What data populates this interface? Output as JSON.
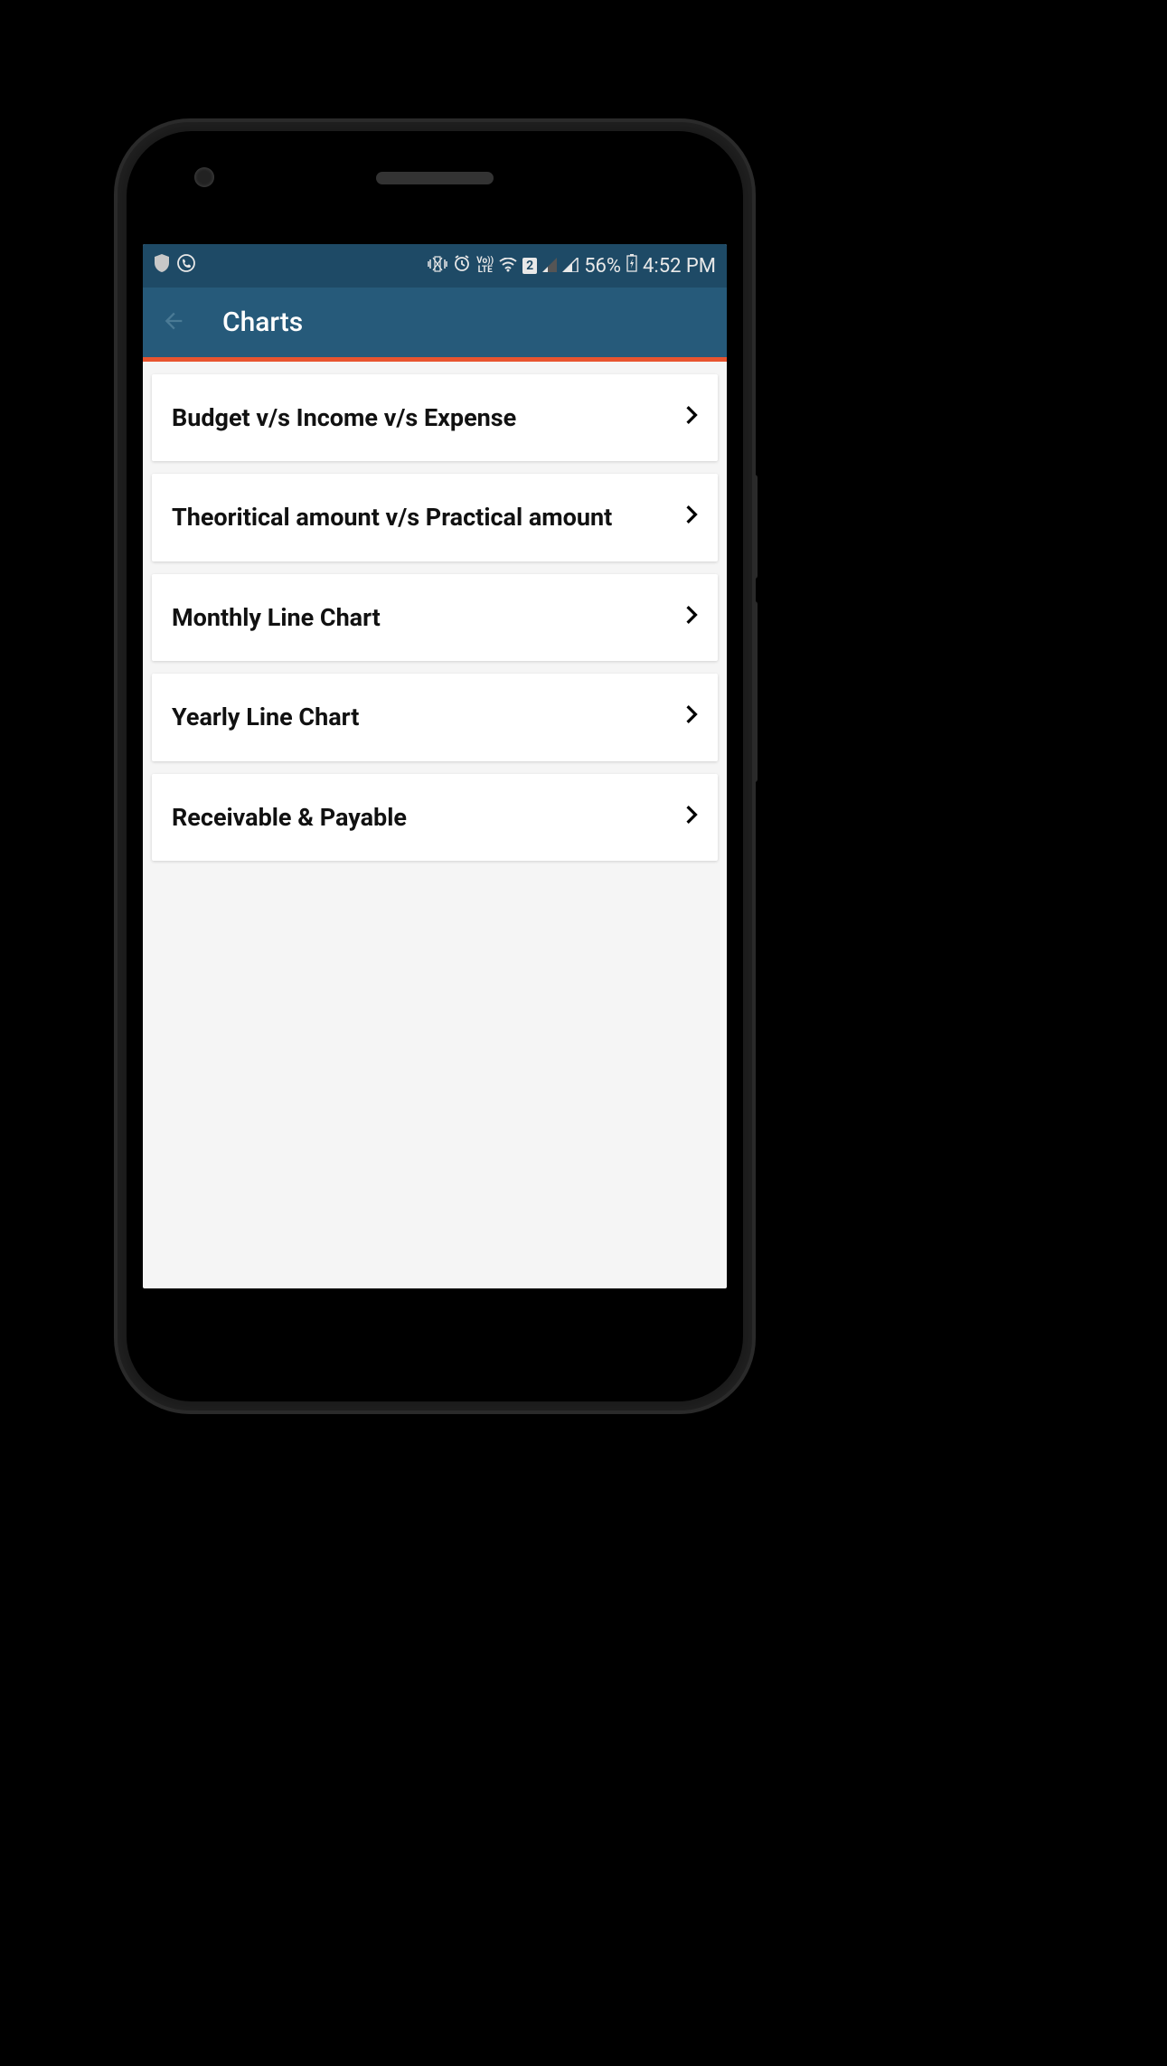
{
  "statusBar": {
    "battery": "56%",
    "time": "4:52 PM",
    "volte": "Vo))\nLTE",
    "sim": "2"
  },
  "appBar": {
    "title": "Charts"
  },
  "items": [
    {
      "label": "Budget v/s Income v/s Expense"
    },
    {
      "label": "Theoritical amount v/s Practical amount"
    },
    {
      "label": "Monthly Line Chart"
    },
    {
      "label": "Yearly Line Chart"
    },
    {
      "label": "Receivable & Payable"
    }
  ]
}
